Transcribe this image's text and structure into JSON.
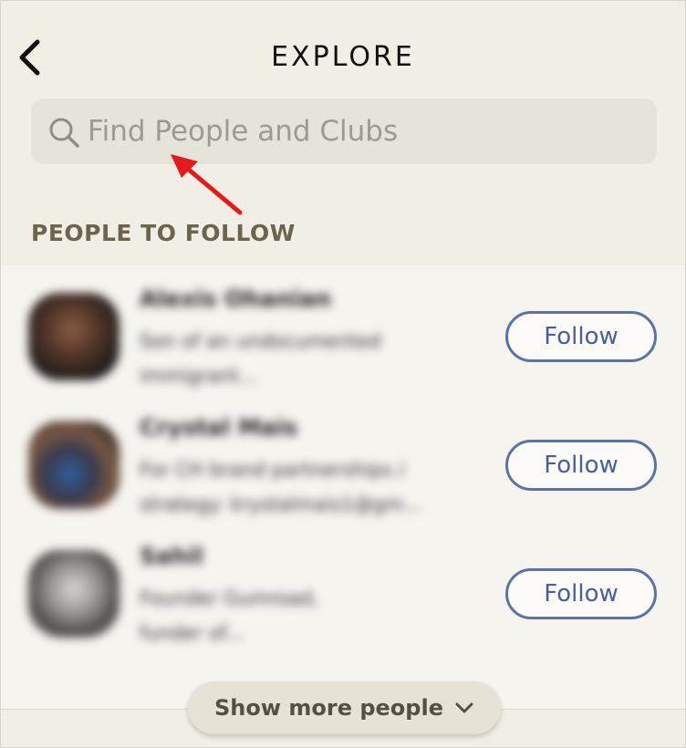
{
  "header": {
    "title": "EXPLORE",
    "back_icon": "chevron-left-icon"
  },
  "search": {
    "placeholder": "Find People and Clubs",
    "value": "",
    "icon": "search-icon"
  },
  "annotation": {
    "icon": "red-arrow-icon",
    "color": "#e41b1b"
  },
  "section": {
    "title": "PEOPLE TO FOLLOW"
  },
  "people": [
    {
      "name": "Alexis Ohanian",
      "bio_line1": "Son of an undocumented",
      "bio_line2": "immigrant...",
      "follow_label": "Follow"
    },
    {
      "name": "Crystal Mais",
      "bio_line1": "For CH brand partnerships /",
      "bio_line2": "strategy: krystalmais1@gm...",
      "follow_label": "Follow"
    },
    {
      "name": "Sahil",
      "bio_line1": "Founder Gumroad,",
      "bio_line2": "funder of...",
      "follow_label": "Follow"
    }
  ],
  "show_more": {
    "label": "Show more people",
    "icon": "chevron-down-icon"
  },
  "colors": {
    "background": "#f1eee5",
    "accent": "#5a73a6",
    "section_title": "#6d6450"
  }
}
